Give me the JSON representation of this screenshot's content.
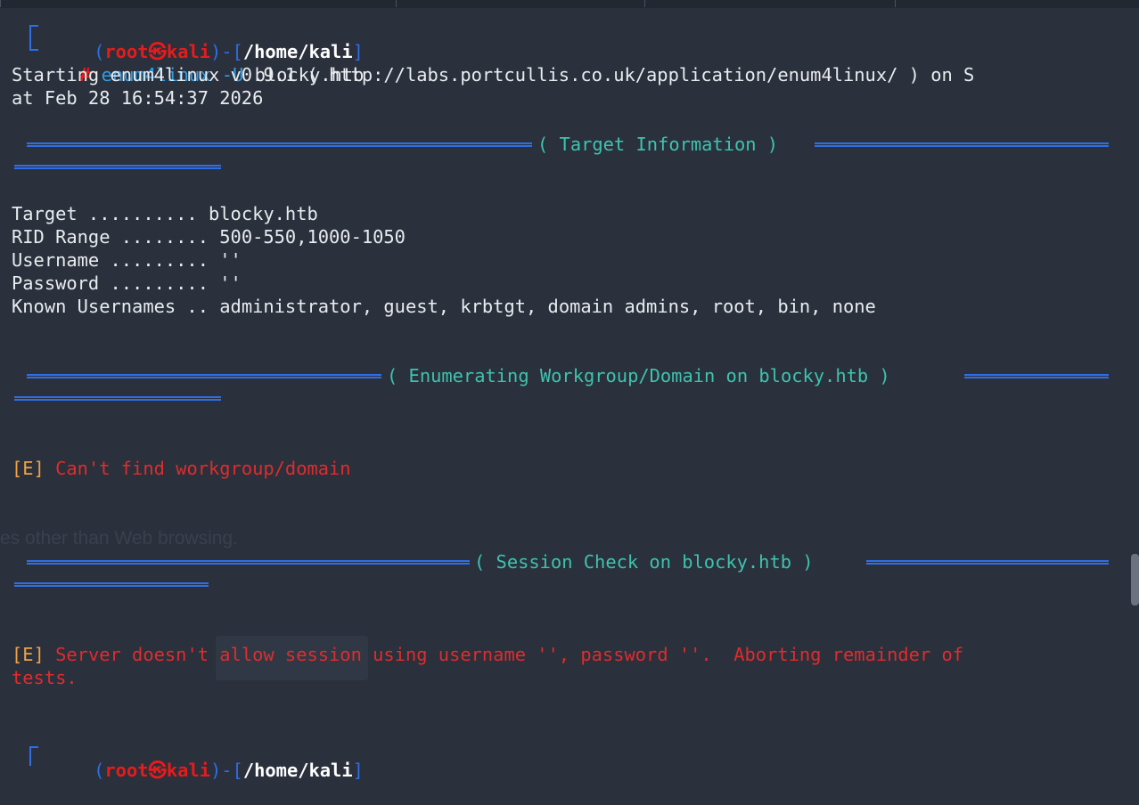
{
  "prompt1": {
    "open": "(",
    "user": "root",
    "skull": "㉿",
    "host": "kali",
    "close": ")-[",
    "path": "/home/kali",
    "end": "]",
    "hash": "#",
    "command": "enum4linux",
    "flag": "-U",
    "arg": "blocky.htb"
  },
  "starting": {
    "line1": "Starting enum4linux v0.9.1 ( http://labs.portcullis.co.uk/application/enum4linux/ ) on S",
    "line2": "at Feb 28 16:54:37 2026"
  },
  "sections": [
    {
      "title": "( Target Information )"
    },
    {
      "title": "( Enumerating Workgroup/Domain on blocky.htb )"
    },
    {
      "title": "( Session Check on blocky.htb )"
    }
  ],
  "target_info": [
    {
      "key": "Target ..........",
      "value": "blocky.htb"
    },
    {
      "key": "RID Range ........",
      "value": "500-550,1000-1050"
    },
    {
      "key": "Username .........",
      "value": "''"
    },
    {
      "key": "Password .........",
      "value": "''"
    },
    {
      "key": "Known Usernames ..",
      "value": "administrator, guest, krbtgt, domain admins, root, bin, none"
    }
  ],
  "errors": [
    {
      "tag": "[E]",
      "text": "Can't find workgroup/domain"
    },
    {
      "tag": "[E]",
      "text": "Server doesn't allow session using username '', password ''.  Aborting remainder of",
      "text2": "tests."
    }
  ],
  "background_ghost_text": "es other than Web browsing.",
  "prompt2": {
    "open": "(",
    "user": "root",
    "skull": "㉿",
    "host": "kali",
    "close": ")-[",
    "path": "/home/kali",
    "end": "]"
  },
  "colors": {
    "background": "#2a303c",
    "prompt_blue": "#2f6ee6",
    "root_red": "#e81b1b",
    "section_cyan": "#3ec3ae",
    "error_tag_orange": "#eea244",
    "error_red": "#e02c2c"
  }
}
